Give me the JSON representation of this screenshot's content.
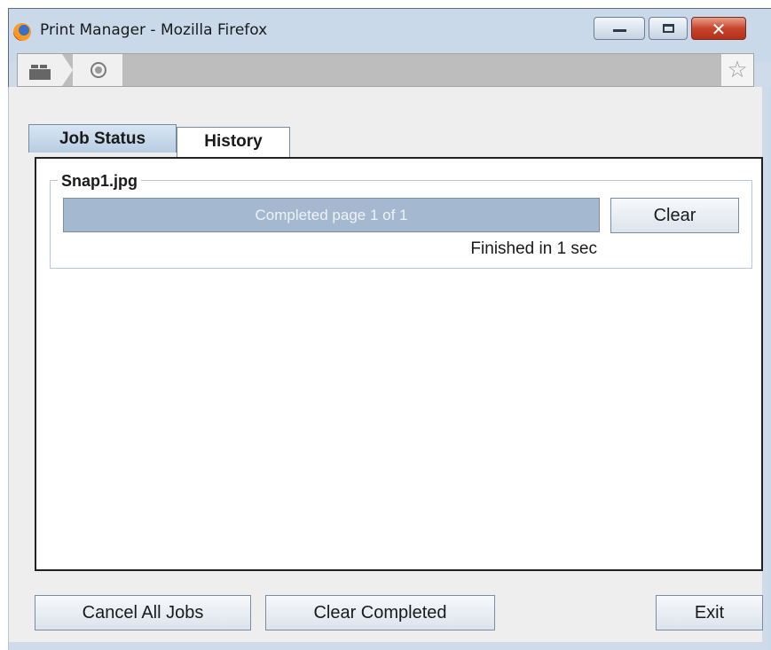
{
  "window": {
    "title": "Print Manager - Mozilla Firefox",
    "close_glyph": "✕"
  },
  "navbar": {
    "star_glyph": "☆"
  },
  "tabs": [
    {
      "label": "Job Status",
      "selected": true
    },
    {
      "label": "History",
      "selected": false
    }
  ],
  "job": {
    "name": "Snap1.jpg",
    "progress_text": "Completed page 1 of 1",
    "progress_fraction": 1.0,
    "clear_label": "Clear",
    "finished_text": "Finished in 1 sec"
  },
  "footer": {
    "cancel_all_label": "Cancel All Jobs",
    "clear_completed_label": "Clear Completed",
    "exit_label": "Exit"
  },
  "colors": {
    "progress_fill": "#a4b9d0",
    "titlebar": "#c9d9ea",
    "close_button": "#c7452b"
  }
}
